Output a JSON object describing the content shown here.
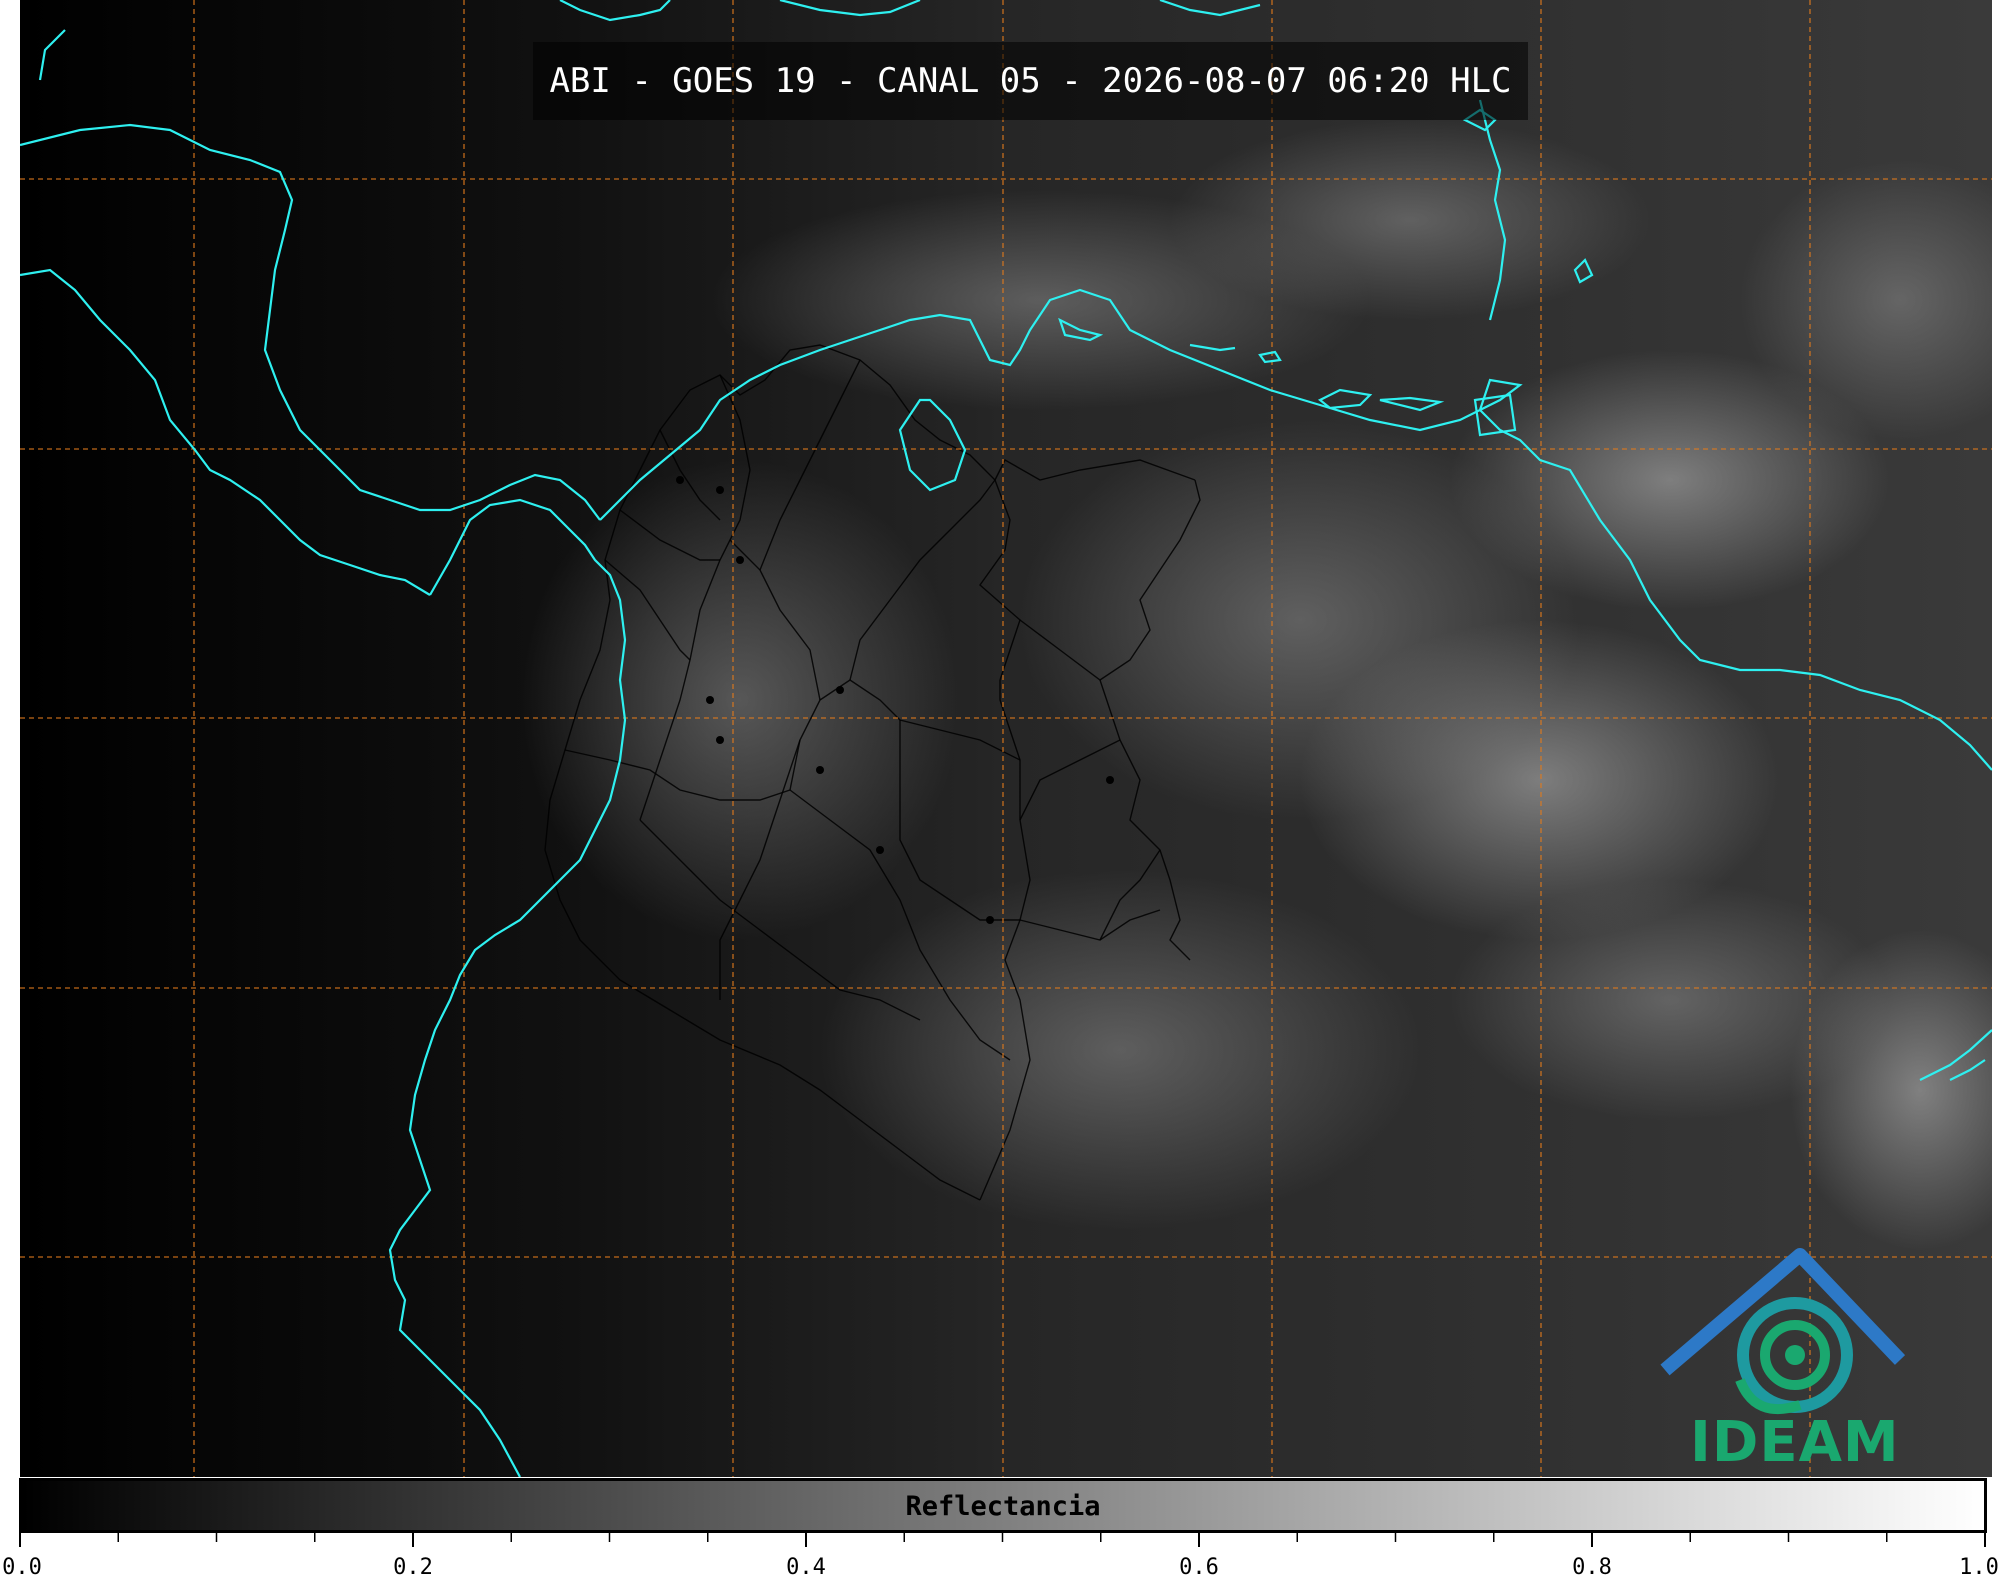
{
  "title": "ABI - GOES 19 - CANAL 05 - 2026-08-07 06:20 HLC",
  "colorbar": {
    "label": "Reflectancia",
    "min": 0.0,
    "max": 1.0,
    "major_ticks": [
      "0.0",
      "0.2",
      "0.4",
      "0.6",
      "0.8",
      "1.0"
    ],
    "minor_tick_step": 0.05,
    "colormap": "grayscale black-to-white"
  },
  "logo": {
    "text": "IDEAM",
    "colors": {
      "top": "#2d79c7",
      "bottom": "#1aa86f"
    }
  },
  "colors": {
    "coastline": "#2ef0f0",
    "gridlines": "#e07a1c",
    "borders": "#000000"
  },
  "map": {
    "gridlines": "dashed",
    "coastlines": true,
    "political_borders": true
  }
}
